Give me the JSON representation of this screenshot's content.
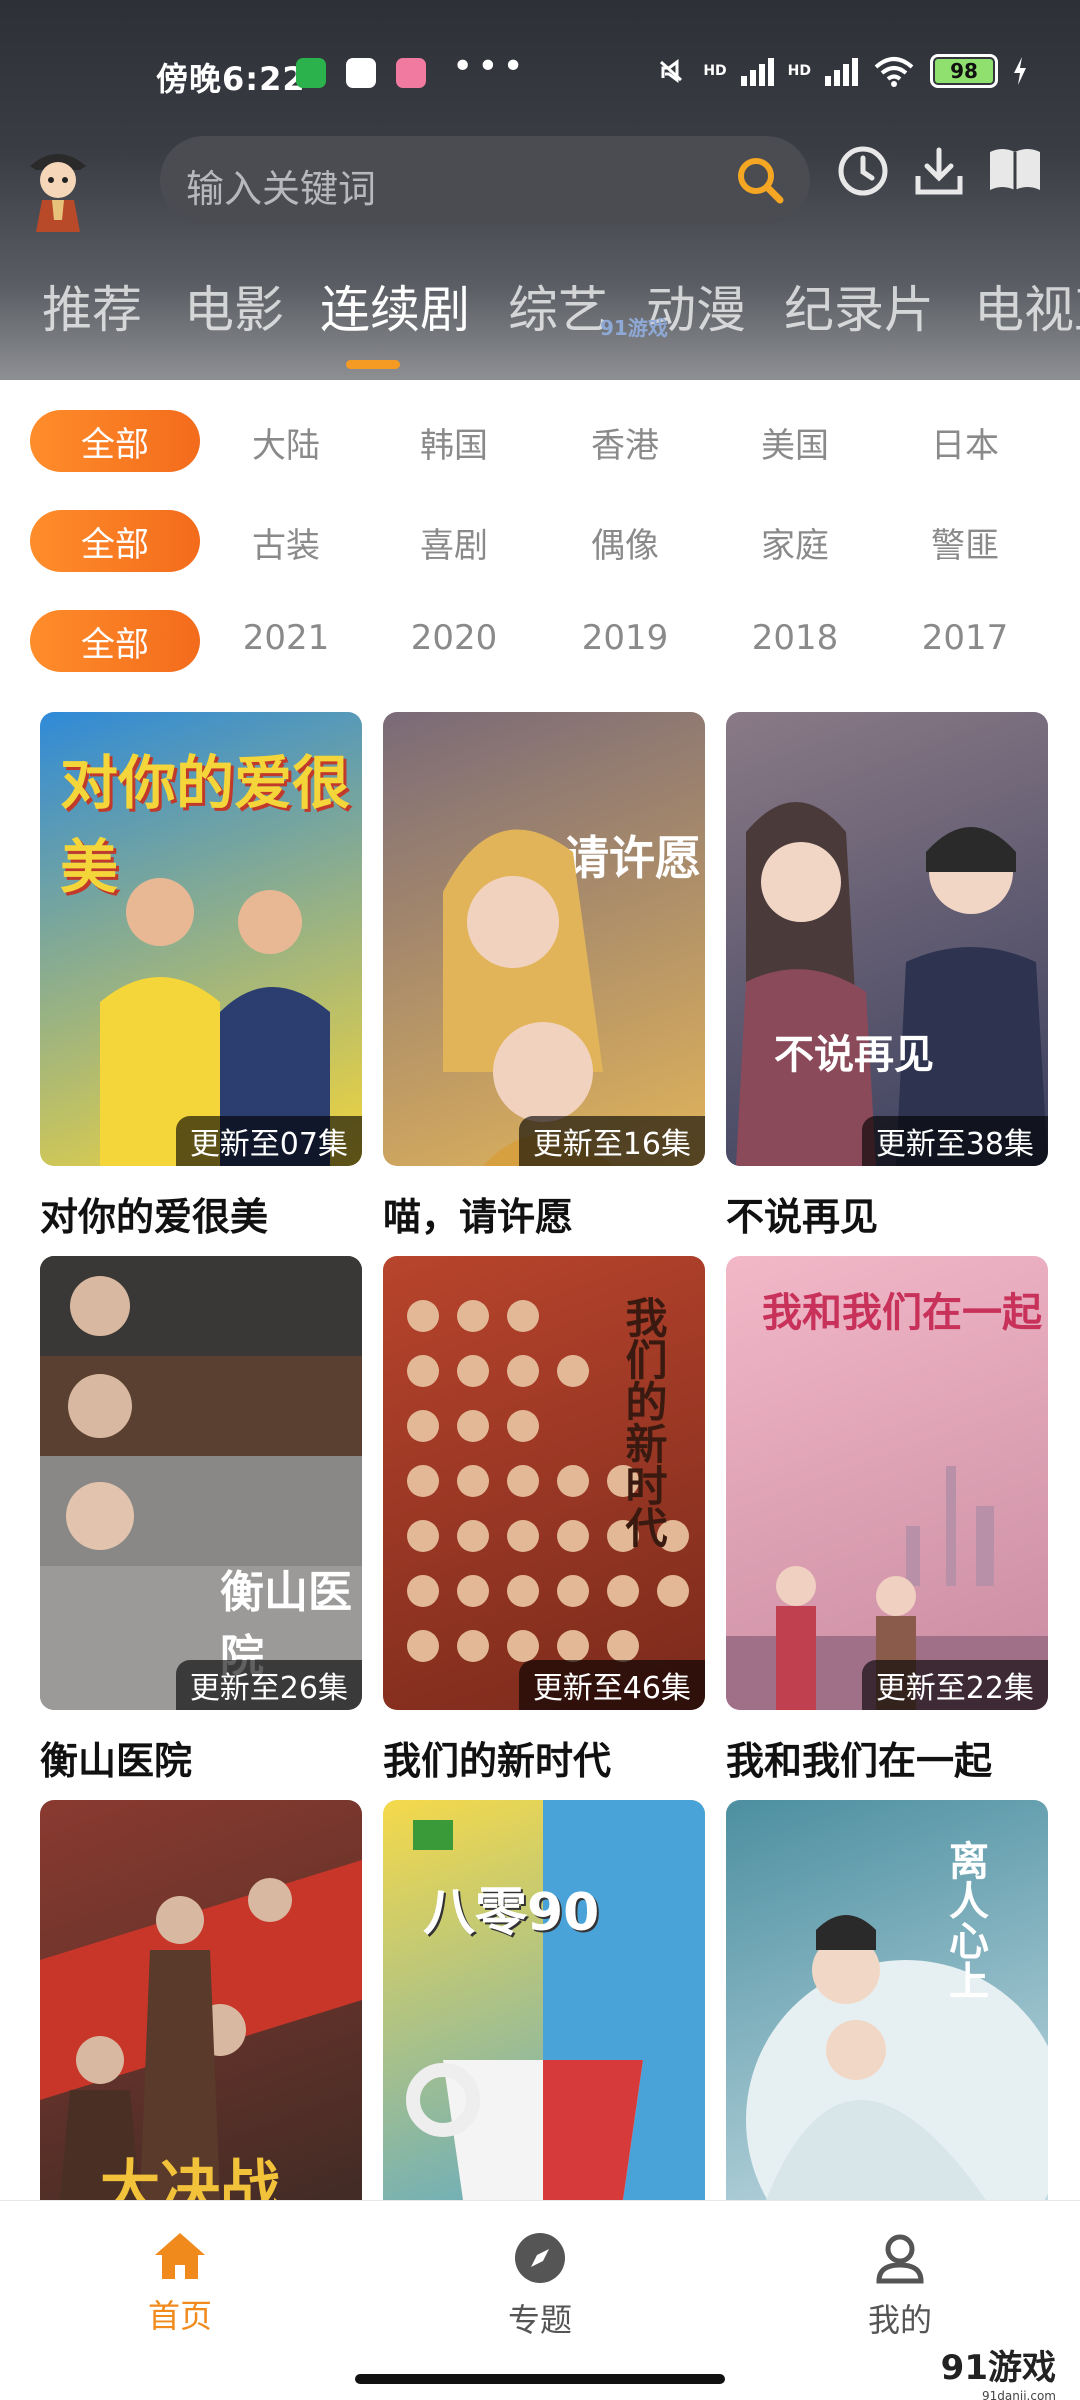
{
  "status_bar": {
    "time": "傍晚6:22",
    "dots": "•••",
    "signal_label_1": "HD",
    "signal_label_2": "HD",
    "battery": "98"
  },
  "search": {
    "placeholder": "输入关键词"
  },
  "categories": [
    "推荐",
    "电影",
    "连续剧",
    "综艺",
    "动漫",
    "纪录片",
    "电视直"
  ],
  "active_category_index": 2,
  "watermark": "91游戏",
  "filters": {
    "region": {
      "all": "全部",
      "options": [
        "大陆",
        "韩国",
        "香港",
        "美国",
        "日本"
      ]
    },
    "genre": {
      "all": "全部",
      "options": [
        "古装",
        "喜剧",
        "偶像",
        "家庭",
        "警匪"
      ]
    },
    "year": {
      "all": "全部",
      "options": [
        "2021",
        "2020",
        "2019",
        "2018",
        "2017"
      ]
    }
  },
  "shows": [
    {
      "title": "对你的爱很美",
      "update": "更新至07集",
      "poster_text": "对你的爱很美",
      "colors": [
        "#2f8ad8",
        "#f4d53a"
      ]
    },
    {
      "title": "喵，请许愿",
      "update": "更新至16集",
      "poster_text": "请许愿",
      "colors": [
        "#7a6a78",
        "#e2b45a"
      ]
    },
    {
      "title": "不说再见",
      "update": "更新至38集",
      "poster_text": "不说再见",
      "colors": [
        "#8a7a86",
        "#3a3f5e"
      ]
    },
    {
      "title": "衡山医院",
      "update": "更新至26集",
      "poster_text": "衡山医院",
      "colors": [
        "#4d4a48",
        "#9a9896"
      ]
    },
    {
      "title": "我们的新时代",
      "update": "更新至46集",
      "poster_text": "我们的新时代",
      "colors": [
        "#b8442c",
        "#7a2a1c"
      ]
    },
    {
      "title": "我和我们在一起",
      "update": "更新至22集",
      "poster_text": "我和我们在一起",
      "colors": [
        "#f2b8c8",
        "#c88aa0"
      ]
    },
    {
      "title": "",
      "update": "",
      "poster_text": "大决战",
      "colors": [
        "#8a3a30",
        "#3a2a24"
      ]
    },
    {
      "title": "",
      "update": "",
      "poster_text": "八零90",
      "colors": [
        "#f5d94a",
        "#4aa3d8"
      ]
    },
    {
      "title": "",
      "update": "",
      "poster_text": "离人心上",
      "colors": [
        "#4c8fa0",
        "#cfe3ea"
      ]
    }
  ],
  "bottom_nav": [
    {
      "label": "首页",
      "icon": "home-icon",
      "active": true
    },
    {
      "label": "专题",
      "icon": "compass-icon",
      "active": false
    },
    {
      "label": "我的",
      "icon": "user-icon",
      "active": false
    }
  ],
  "brand": {
    "name": "91游戏",
    "url": "91danji.com"
  },
  "accent_color": "#f58b22"
}
